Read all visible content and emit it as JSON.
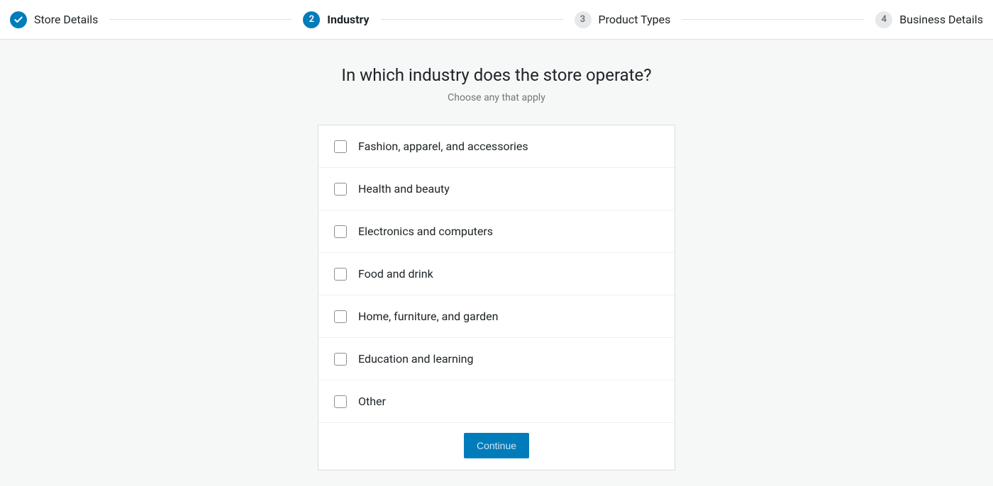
{
  "stepper": {
    "steps": [
      {
        "label": "Store Details",
        "state": "done"
      },
      {
        "number": "2",
        "label": "Industry",
        "state": "active"
      },
      {
        "number": "3",
        "label": "Product Types",
        "state": "pending"
      },
      {
        "number": "4",
        "label": "Business Details",
        "state": "pending"
      }
    ]
  },
  "question": {
    "title": "In which industry does the store operate?",
    "subtitle": "Choose any that apply"
  },
  "options": [
    {
      "label": "Fashion, apparel, and accessories"
    },
    {
      "label": "Health and beauty"
    },
    {
      "label": "Electronics and computers"
    },
    {
      "label": "Food and drink"
    },
    {
      "label": "Home, furniture, and garden"
    },
    {
      "label": "Education and learning"
    },
    {
      "label": "Other"
    }
  ],
  "actions": {
    "continue_label": "Continue"
  },
  "colors": {
    "primary": "#007cba",
    "pending_bg": "#e7e8e9",
    "page_bg": "#f6f7f7"
  }
}
